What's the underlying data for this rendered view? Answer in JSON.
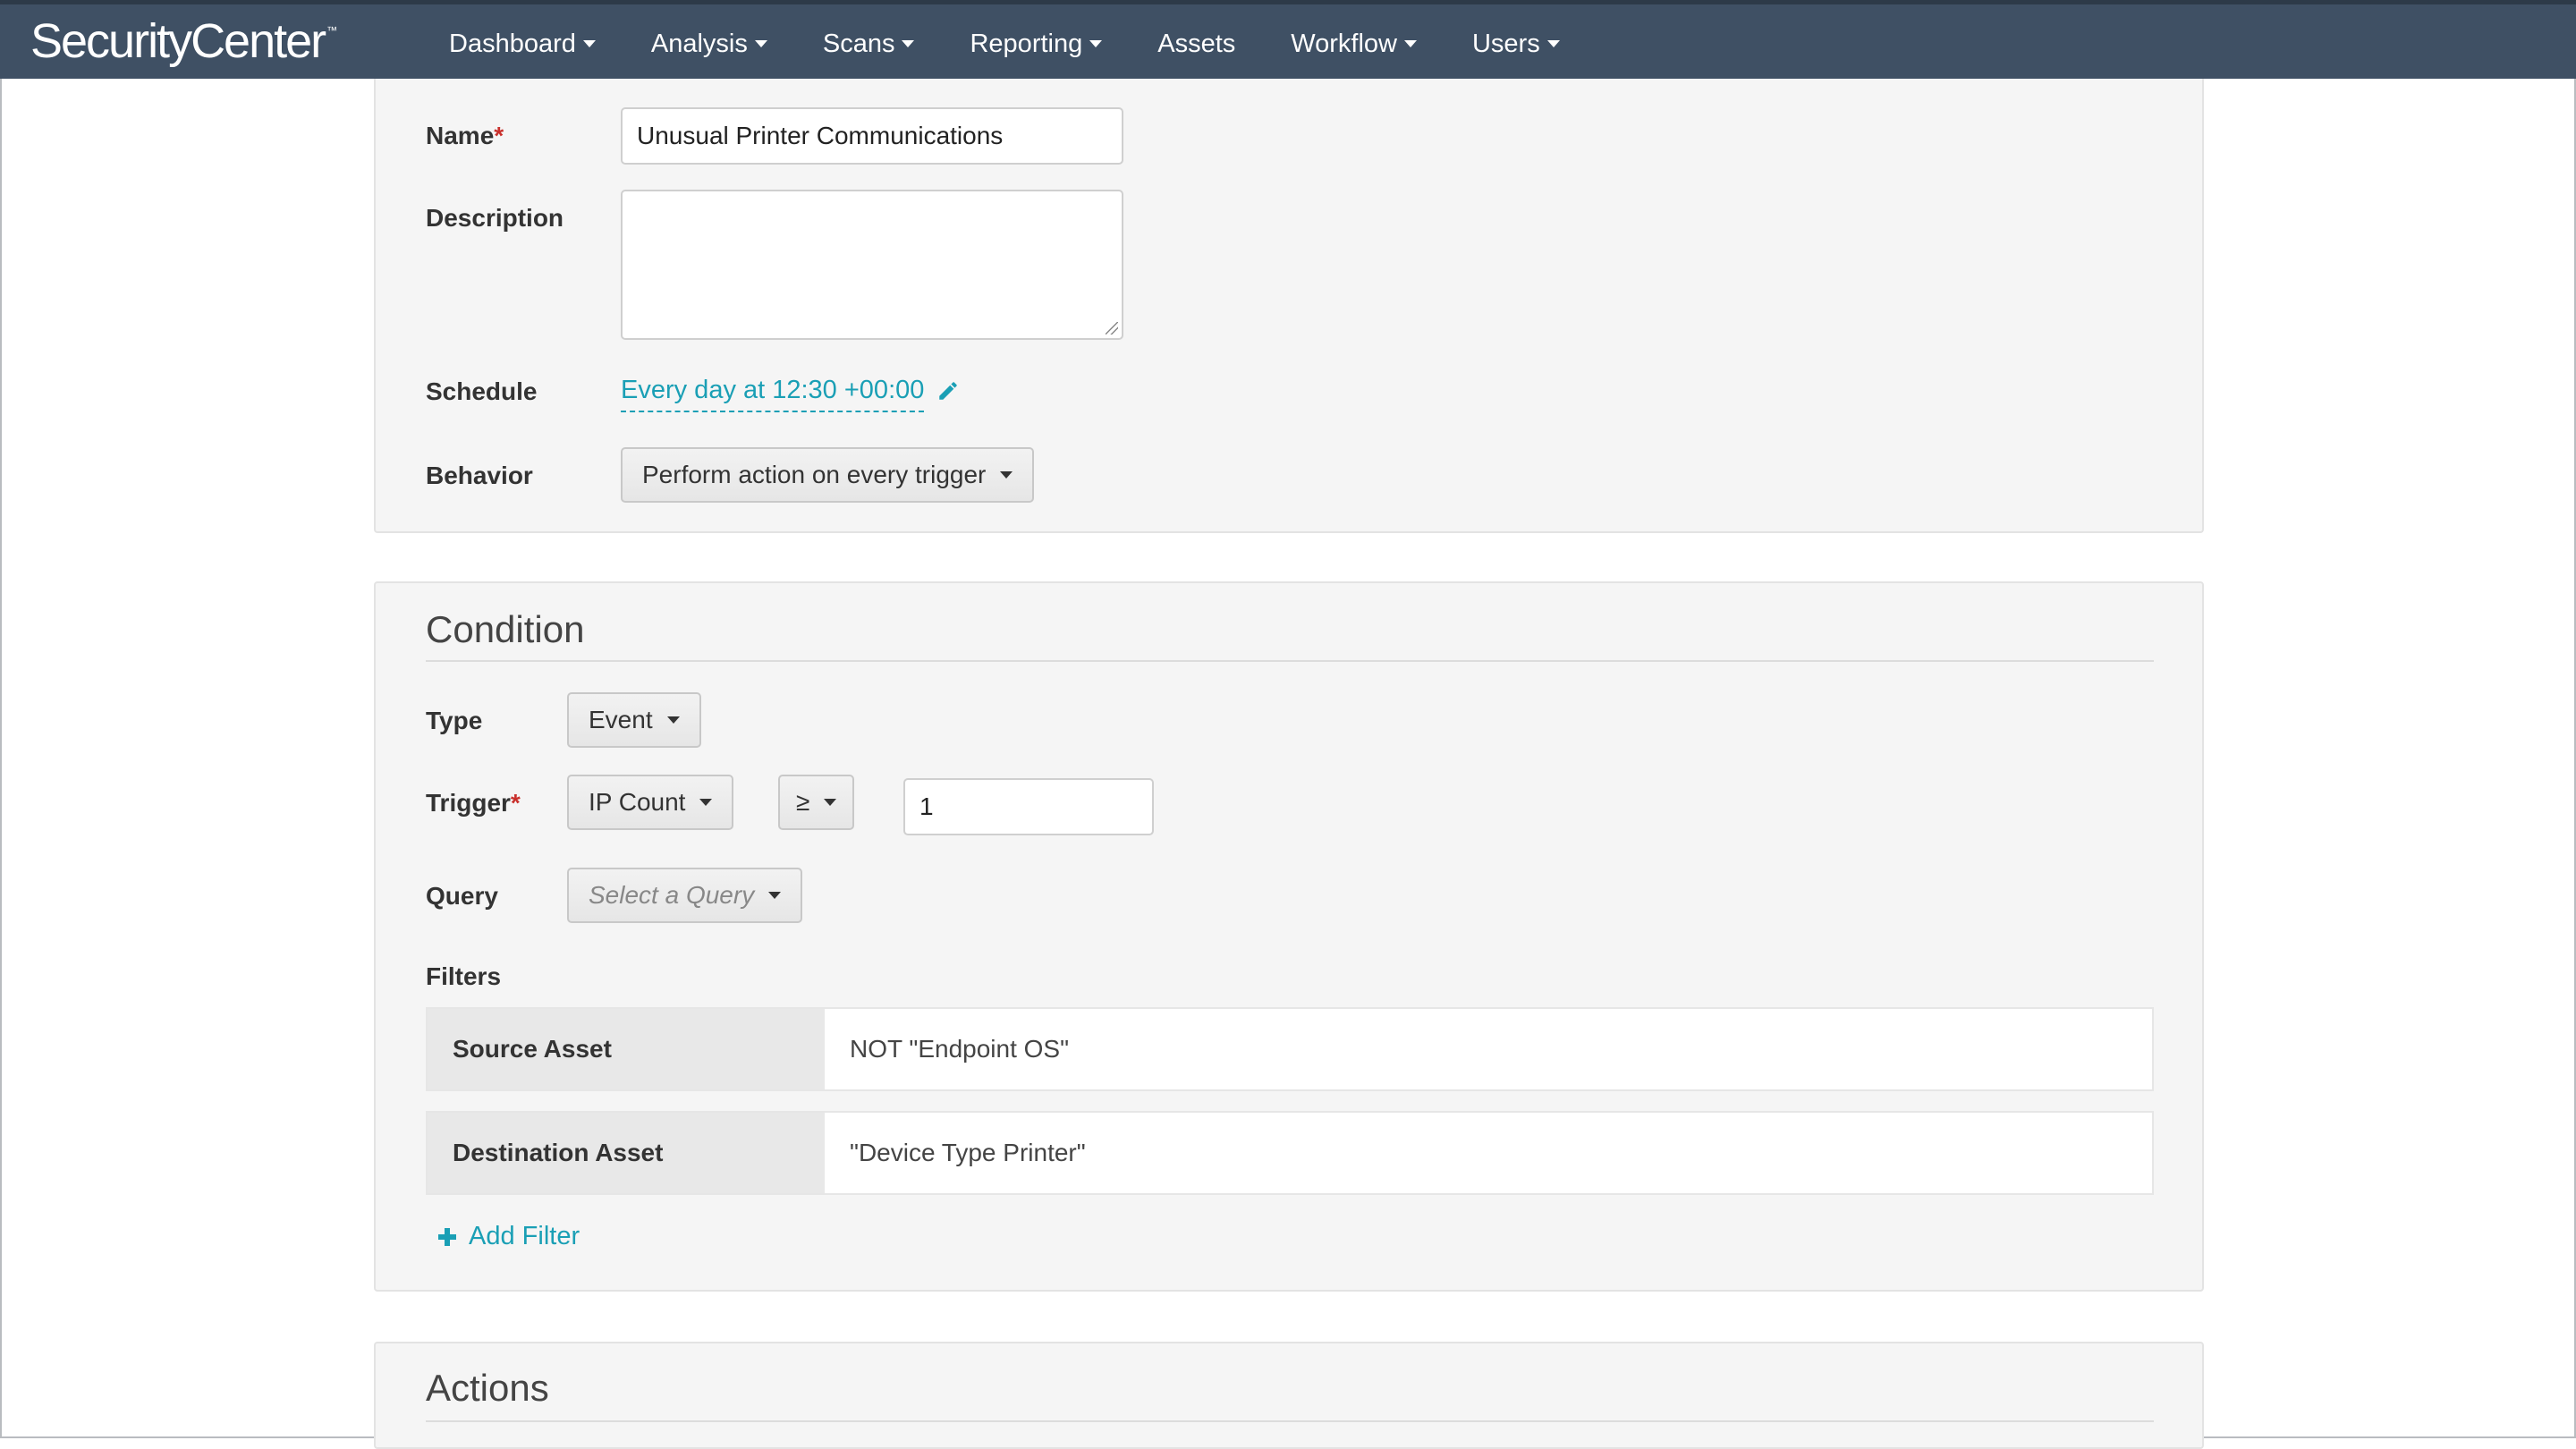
{
  "app": {
    "brand": "SecurityCenter",
    "trademark": "™"
  },
  "nav": [
    {
      "label": "Dashboard",
      "has_caret": true
    },
    {
      "label": "Analysis",
      "has_caret": true
    },
    {
      "label": "Scans",
      "has_caret": true
    },
    {
      "label": "Reporting",
      "has_caret": true
    },
    {
      "label": "Assets",
      "has_caret": false
    },
    {
      "label": "Workflow",
      "has_caret": true
    },
    {
      "label": "Users",
      "has_caret": true
    }
  ],
  "general": {
    "name_label": "Name",
    "required_mark": "*",
    "name_value": "Unusual Printer Communications",
    "description_label": "Description",
    "description_value": "",
    "schedule_label": "Schedule",
    "schedule_value": "Every day at 12:30 +00:00",
    "behavior_label": "Behavior",
    "behavior_value": "Perform action on every trigger"
  },
  "condition": {
    "title": "Condition",
    "type_label": "Type",
    "type_value": "Event",
    "trigger_label": "Trigger",
    "trigger_value": "IP Count",
    "operator_value": "≥",
    "threshold_value": "1",
    "query_label": "Query",
    "query_placeholder": "Select a Query",
    "filters_label": "Filters",
    "filters": [
      {
        "key": "Source Asset",
        "value": "NOT \"Endpoint OS\""
      },
      {
        "key": "Destination Asset",
        "value": "\"Device Type Printer\""
      }
    ],
    "add_filter_label": "Add Filter"
  },
  "actions": {
    "title": "Actions"
  },
  "colors": {
    "navbar": "#3f5064",
    "link": "#1a9fb5",
    "required": "#c9302c",
    "panel_bg": "#f5f5f5"
  },
  "icons": {
    "edit": "pencil-icon",
    "add": "plus-icon",
    "dropdown": "caret-down-icon"
  }
}
